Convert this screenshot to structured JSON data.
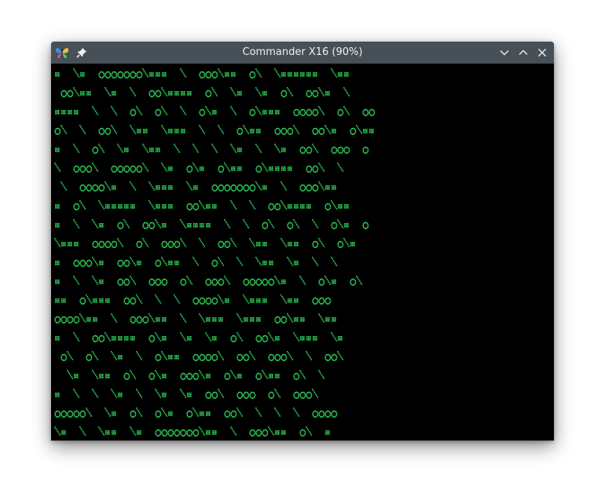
{
  "window": {
    "title": "Commander X16 (90%)"
  },
  "icons": {
    "app": "butterfly-icon",
    "pin": "pin-icon",
    "minimize": "chevron-down-icon",
    "maximize": "chevron-up-icon",
    "close": "close-icon"
  },
  "colors": {
    "titlebar": "#475057",
    "title_text": "#eff0f1",
    "screen_bg": "#000000",
    "glyph": "#2fd35a"
  },
  "screen": {
    "rows": [
      "#  \\#  OOOOOOO\\###  \\  OOO\\##  O\\  \\######  \\##",
      " OO\\##  \\#  \\  OO\\####  O\\  \\#  \\#  O\\  OO\\#  \\",
      "####  \\  \\  O\\  O\\  \\  O\\#  \\  O\\###  OOOO\\  O\\  OO",
      "O\\  \\  OO\\  \\##  \\###  \\  \\  O\\##  OOO\\  OO\\#  O\\##",
      "#  \\  O\\  \\#  \\##  \\  \\  \\  \\#  \\  \\#  OO\\  OOO  O",
      "\\  OOO\\  OOOOO\\  \\#  O\\#  O\\##  O\\####  OO\\  \\",
      " \\  OOOO\\#  \\  \\###  \\#  OOOOOOO\\#  \\  OOO\\##",
      "#  O\\  \\#####  \\###  OO\\##  \\  \\  OO\\####  O\\##",
      "#  \\  \\#  O\\  OO\\#  \\####  \\  \\  O\\  O\\  \\  O\\#  O",
      "\\###  OOOO\\  O\\  OOO\\  \\  OO\\  \\##  \\##  O\\  O\\#",
      "#  OOO\\#  OO\\#  O\\##  \\  O\\  \\  \\##  \\#  \\  \\",
      "#  \\  \\#  OO\\  OOO  O\\  OOO\\  OOOOO\\#  \\  O\\#  O\\",
      "##  O\\###  OO\\  \\  \\  OOOO\\#  \\###  \\##  OOO",
      "OOOO\\##  \\  OOO\\##  \\  \\###  \\###  OO\\##  \\##",
      "#  \\  OO\\####  O\\#  \\#  \\#  O\\  OO\\#  \\###  \\#",
      " O\\  O\\  \\#  \\  O\\##  OOOO\\  OO\\  OOO\\  \\  OO\\",
      "  \\#  \\##  O\\  O\\#  OOO\\#  O\\#  O\\##  O\\  \\",
      "#  \\  \\  \\#  \\  \\#  \\#  OO\\  OOO  O\\  OOO\\",
      "OOOOO\\  \\#  O\\  O\\#  O\\##  OO\\  \\  \\  \\  OOOO",
      "\\#  \\  \\##  \\#  OOOOOOO\\##  \\  OOO\\##  O\\  #"
    ]
  }
}
